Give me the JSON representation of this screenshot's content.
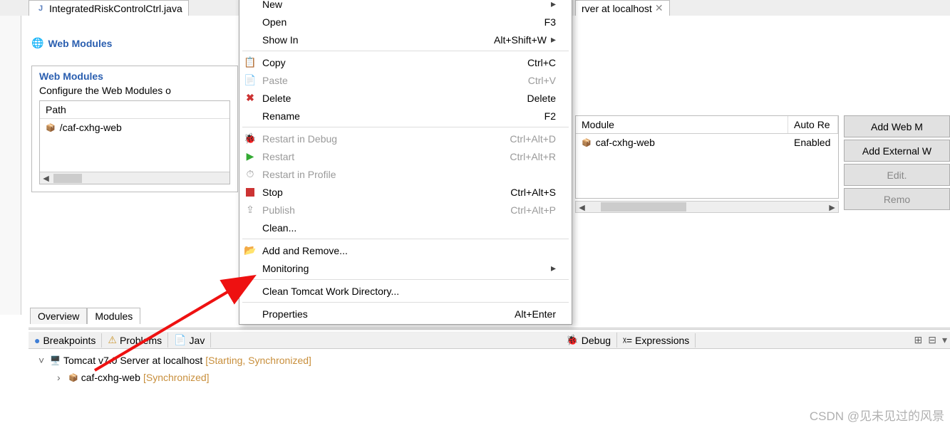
{
  "topTabs": {
    "editor1": "IntegratedRiskControlCtrl.java",
    "editor2": "rver at localhost"
  },
  "webModules": {
    "titleIcon": "web-icon",
    "title": "Web Modules",
    "boxHeader": "Web Modules",
    "boxDesc": "Configure the Web Modules o",
    "colPath": "Path",
    "rows": [
      {
        "path": "/caf-cxhg-web"
      }
    ]
  },
  "rightModules": {
    "colModule": "Module",
    "colAuto": "Auto Re",
    "rows": [
      {
        "name": "caf-cxhg-web",
        "auto": "Enabled"
      }
    ]
  },
  "buttons": {
    "addWeb": "Add Web M",
    "addExt": "Add External W",
    "edit": "Edit.",
    "remove": "Remo"
  },
  "ovTabs": {
    "overview": "Overview",
    "modules": "Modules"
  },
  "botTabs": {
    "breakpoints": "Breakpoints",
    "problems": "Problems",
    "jav": "Jav",
    "debug": "Debug",
    "expressions": "Expressions"
  },
  "serversTree": {
    "node1": "Tomcat v7.0 Server at localhost",
    "node1status": "[Starting, Synchronized]",
    "node2": "caf-cxhg-web",
    "node2status": "[Synchronized]"
  },
  "ctx": {
    "new": "New",
    "open": "Open",
    "open_sc": "F3",
    "showIn": "Show In",
    "showIn_sc": "Alt+Shift+W",
    "copy": "Copy",
    "copy_sc": "Ctrl+C",
    "paste": "Paste",
    "paste_sc": "Ctrl+V",
    "delete": "Delete",
    "delete_sc": "Delete",
    "rename": "Rename",
    "rename_sc": "F2",
    "restartDebug": "Restart in Debug",
    "restartDebug_sc": "Ctrl+Alt+D",
    "restart": "Restart",
    "restart_sc": "Ctrl+Alt+R",
    "restartProfile": "Restart in Profile",
    "stop": "Stop",
    "stop_sc": "Ctrl+Alt+S",
    "publish": "Publish",
    "publish_sc": "Ctrl+Alt+P",
    "clean": "Clean...",
    "addRemove": "Add and Remove...",
    "monitoring": "Monitoring",
    "cleanTomcat": "Clean Tomcat Work Directory...",
    "properties": "Properties",
    "properties_sc": "Alt+Enter"
  },
  "watermark": "CSDN @见未见过的风景"
}
